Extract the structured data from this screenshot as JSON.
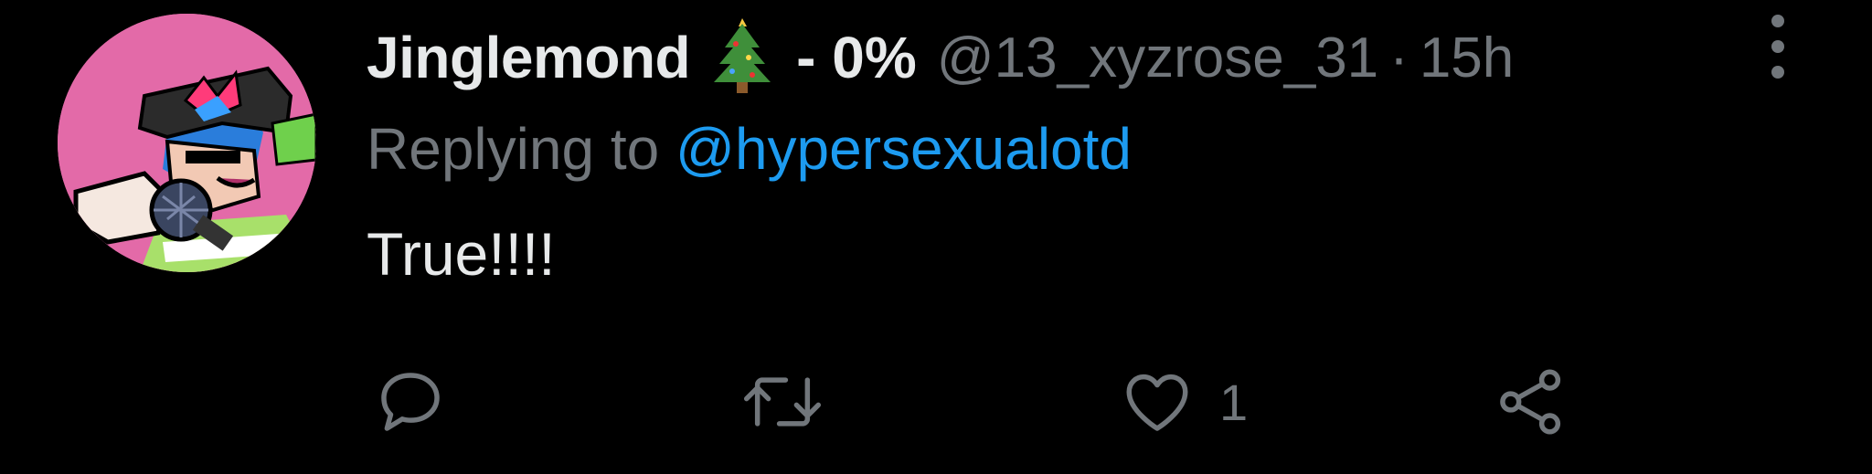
{
  "tweet": {
    "display_name": "Jinglemond",
    "name_suffix": "- 0%",
    "handle": "@13_xyzrose_31",
    "separator": "·",
    "time": "15h",
    "replying_prefix": "Replying to",
    "replying_to": "@hypersexualotd",
    "text": "True!!!!",
    "like_count": "1"
  },
  "colors": {
    "background": "#000000",
    "primary_text": "#e7e9ea",
    "secondary_text": "#71767b",
    "link": "#1d9bf0",
    "avatar_bg": "#e36aa8"
  },
  "icons": {
    "name_emoji": "christmas-tree-icon",
    "more": "more-vertical-icon",
    "reply": "reply-icon",
    "retweet": "retweet-icon",
    "like": "heart-icon",
    "share": "share-icon"
  }
}
